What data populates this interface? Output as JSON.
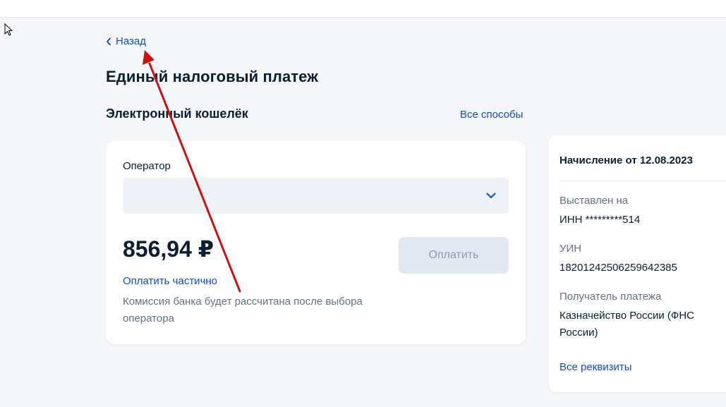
{
  "nav": {
    "back_label": "Назад"
  },
  "page": {
    "title": "Единый налоговый платеж"
  },
  "section": {
    "title": "Электронный кошелёк",
    "all_methods_label": "Все способы"
  },
  "payment": {
    "operator_label": "Оператор",
    "operator_value": "",
    "amount": "856,94 ₽",
    "pay_button_label": "Оплатить",
    "partial_label": "Оплатить частично",
    "commission_text": "Комиссия банка будет рассчитана после выбора оператора"
  },
  "charge": {
    "title": "Начисление от 12.08.2023",
    "issued_to_label": "Выставлен на",
    "issued_to_value": "ИНН *********514",
    "uin_label": "УИН",
    "uin_value": "18201242506259642385",
    "recipient_label": "Получатель платежа",
    "recipient_value": "Казначейство России (ФНС России)",
    "all_details_label": "Все реквизиты"
  },
  "colors": {
    "link": "#0d4cd3",
    "annotation_arrow": "#cc1111",
    "background": "#f5f7fa"
  }
}
